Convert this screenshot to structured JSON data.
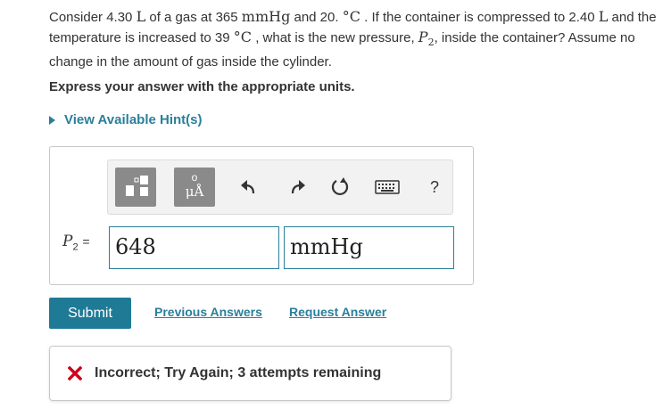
{
  "question": {
    "part1": "Consider 4.30 ",
    "unit_L1": "L",
    "part2": " of a gas at 365 ",
    "unit_mmHg1": "mmHg",
    "part3": " and 20. ",
    "unit_degC1": "°C",
    "part4": " . If the container is compressed to 2.40 ",
    "unit_L2": "L",
    "part5": " and the temperature is increased to 39 ",
    "unit_degC2": "°C",
    "part6": " , what is the new pressure, ",
    "var_P": "P",
    "var_sub": "2",
    "part7": ", inside the container? Assume no change in the amount of gas inside the cylinder."
  },
  "instruction": "Express your answer with the appropriate units.",
  "hint_label": "View Available Hint(s)",
  "answer": {
    "lhs_var": "P",
    "lhs_sub": "2",
    "equals": "=",
    "value": "648",
    "units": "mmHg",
    "units_button_label": "μÅ",
    "help_label": "?"
  },
  "actions": {
    "submit_label": "Submit",
    "previous_answers_label": "Previous Answers",
    "request_answer_label": "Request Answer"
  },
  "feedback": {
    "message": "Incorrect; Try Again; 3 attempts remaining"
  },
  "colors": {
    "accent": "#2a7f9b",
    "submit_bg": "#1f7a96",
    "error": "#d0021b"
  }
}
